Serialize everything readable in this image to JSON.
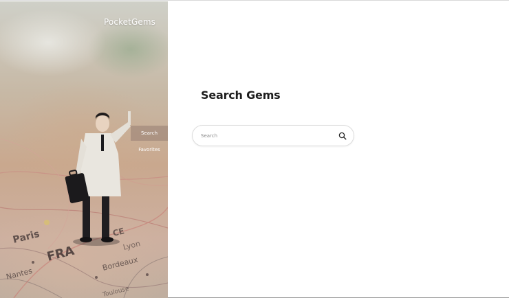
{
  "app": {
    "brand": "PocketGems"
  },
  "sidebar": {
    "nav": [
      {
        "label": "Search",
        "active": true
      },
      {
        "label": "Favorites",
        "active": false
      }
    ],
    "background": "map-photo-with-businessman-figurine"
  },
  "main": {
    "title": "Search Gems",
    "search": {
      "placeholder": "Search",
      "value": "",
      "icon": "search-icon"
    }
  },
  "colors": {
    "title_text": "#1d1d1d",
    "nav_active_bg": "#967d73",
    "search_border": "#dcdcdc"
  }
}
